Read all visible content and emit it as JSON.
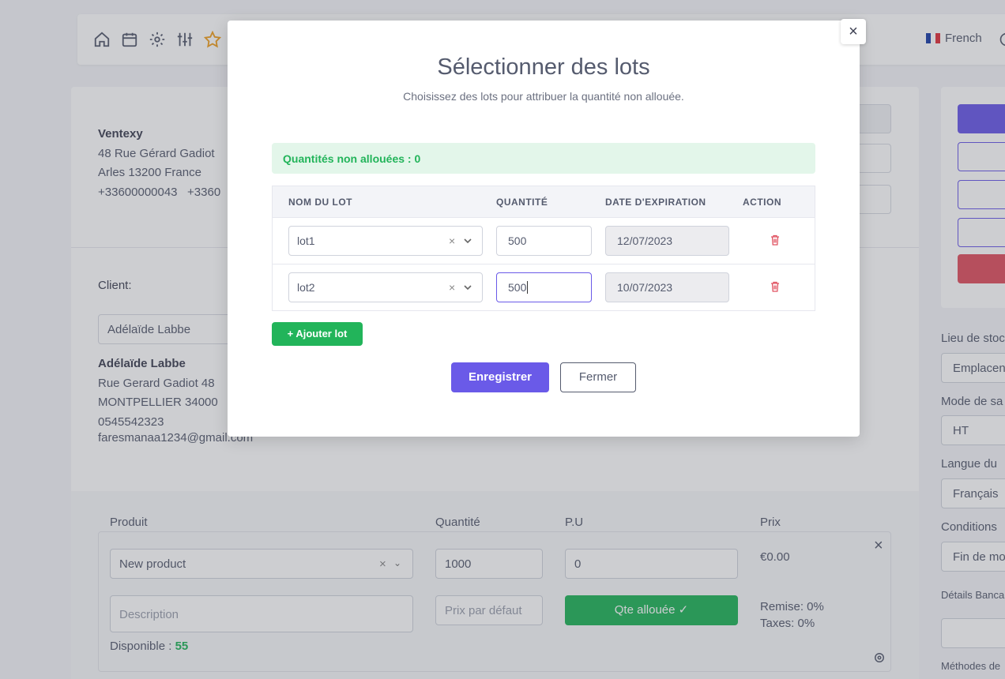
{
  "topbar": {
    "icons": [
      "home-icon",
      "calendar-icon",
      "gear-icon",
      "sliders-icon",
      "star-icon"
    ],
    "language": "French"
  },
  "company": {
    "name": "Ventexy",
    "address": "48 Rue Gérard Gadiot",
    "city": "Arles 13200 France",
    "phone1": "+33600000043",
    "phone2": "+3360"
  },
  "client": {
    "label": "Client:",
    "selected": "Adélaïde Labbe",
    "name": "Adélaïde Labbe",
    "address": "Rue Gerard Gadiot 48",
    "city": "MONTPELLIER 34000",
    "phone": "0545542323",
    "email": "faresmanaa1234@gmail.com"
  },
  "product_table": {
    "headers": {
      "product": "Produit",
      "quantity": "Quantité",
      "unit_price": "P.U",
      "price": "Prix"
    },
    "product": "New product",
    "quantity": "1000",
    "unit_price": "0",
    "price": "€0.00",
    "description_placeholder": "Description",
    "default_price_placeholder": "Prix par défaut",
    "allocated_button": "Qte allouée ✓",
    "discount": "Remise: 0%",
    "taxes": "Taxes: 0%",
    "available_label": "Disponible :",
    "available_value": "55"
  },
  "right_panel": {
    "stock_label": "Lieu de stoc",
    "stock_value": "Emplacen",
    "mode_label": "Mode de sa",
    "mode_value": "HT",
    "lang_label": "Langue du",
    "lang_value": "Français",
    "conditions_label": "Conditions",
    "conditions_value": "Fin de mo",
    "bank_label": "Détails Banca",
    "methods_label": "Méthodes de",
    "colors": {
      "primary": "#6a5ae8",
      "danger": "#e05260"
    }
  },
  "modal": {
    "title": "Sélectionner des lots",
    "subtitle": "Choisissez des lots pour attribuer la quantité non allouée.",
    "unallocated": "Quantités non allouées : 0",
    "headers": {
      "lot_name": "NOM DU LOT",
      "quantity": "QUANTITÉ",
      "expiry": "DATE D'EXPIRATION",
      "action": "ACTION"
    },
    "rows": [
      {
        "lot": "lot1",
        "quantity": "500",
        "expiry": "12/07/2023"
      },
      {
        "lot": "lot2",
        "quantity": "500",
        "expiry": "10/07/2023"
      }
    ],
    "add_lot": "+ Ajouter lot",
    "save": "Enregistrer",
    "close": "Fermer",
    "close_symbol": "×"
  },
  "colors": {
    "green": "#22b45a",
    "primary": "#6a5ae8",
    "alert_bg": "#e3f6ea"
  }
}
